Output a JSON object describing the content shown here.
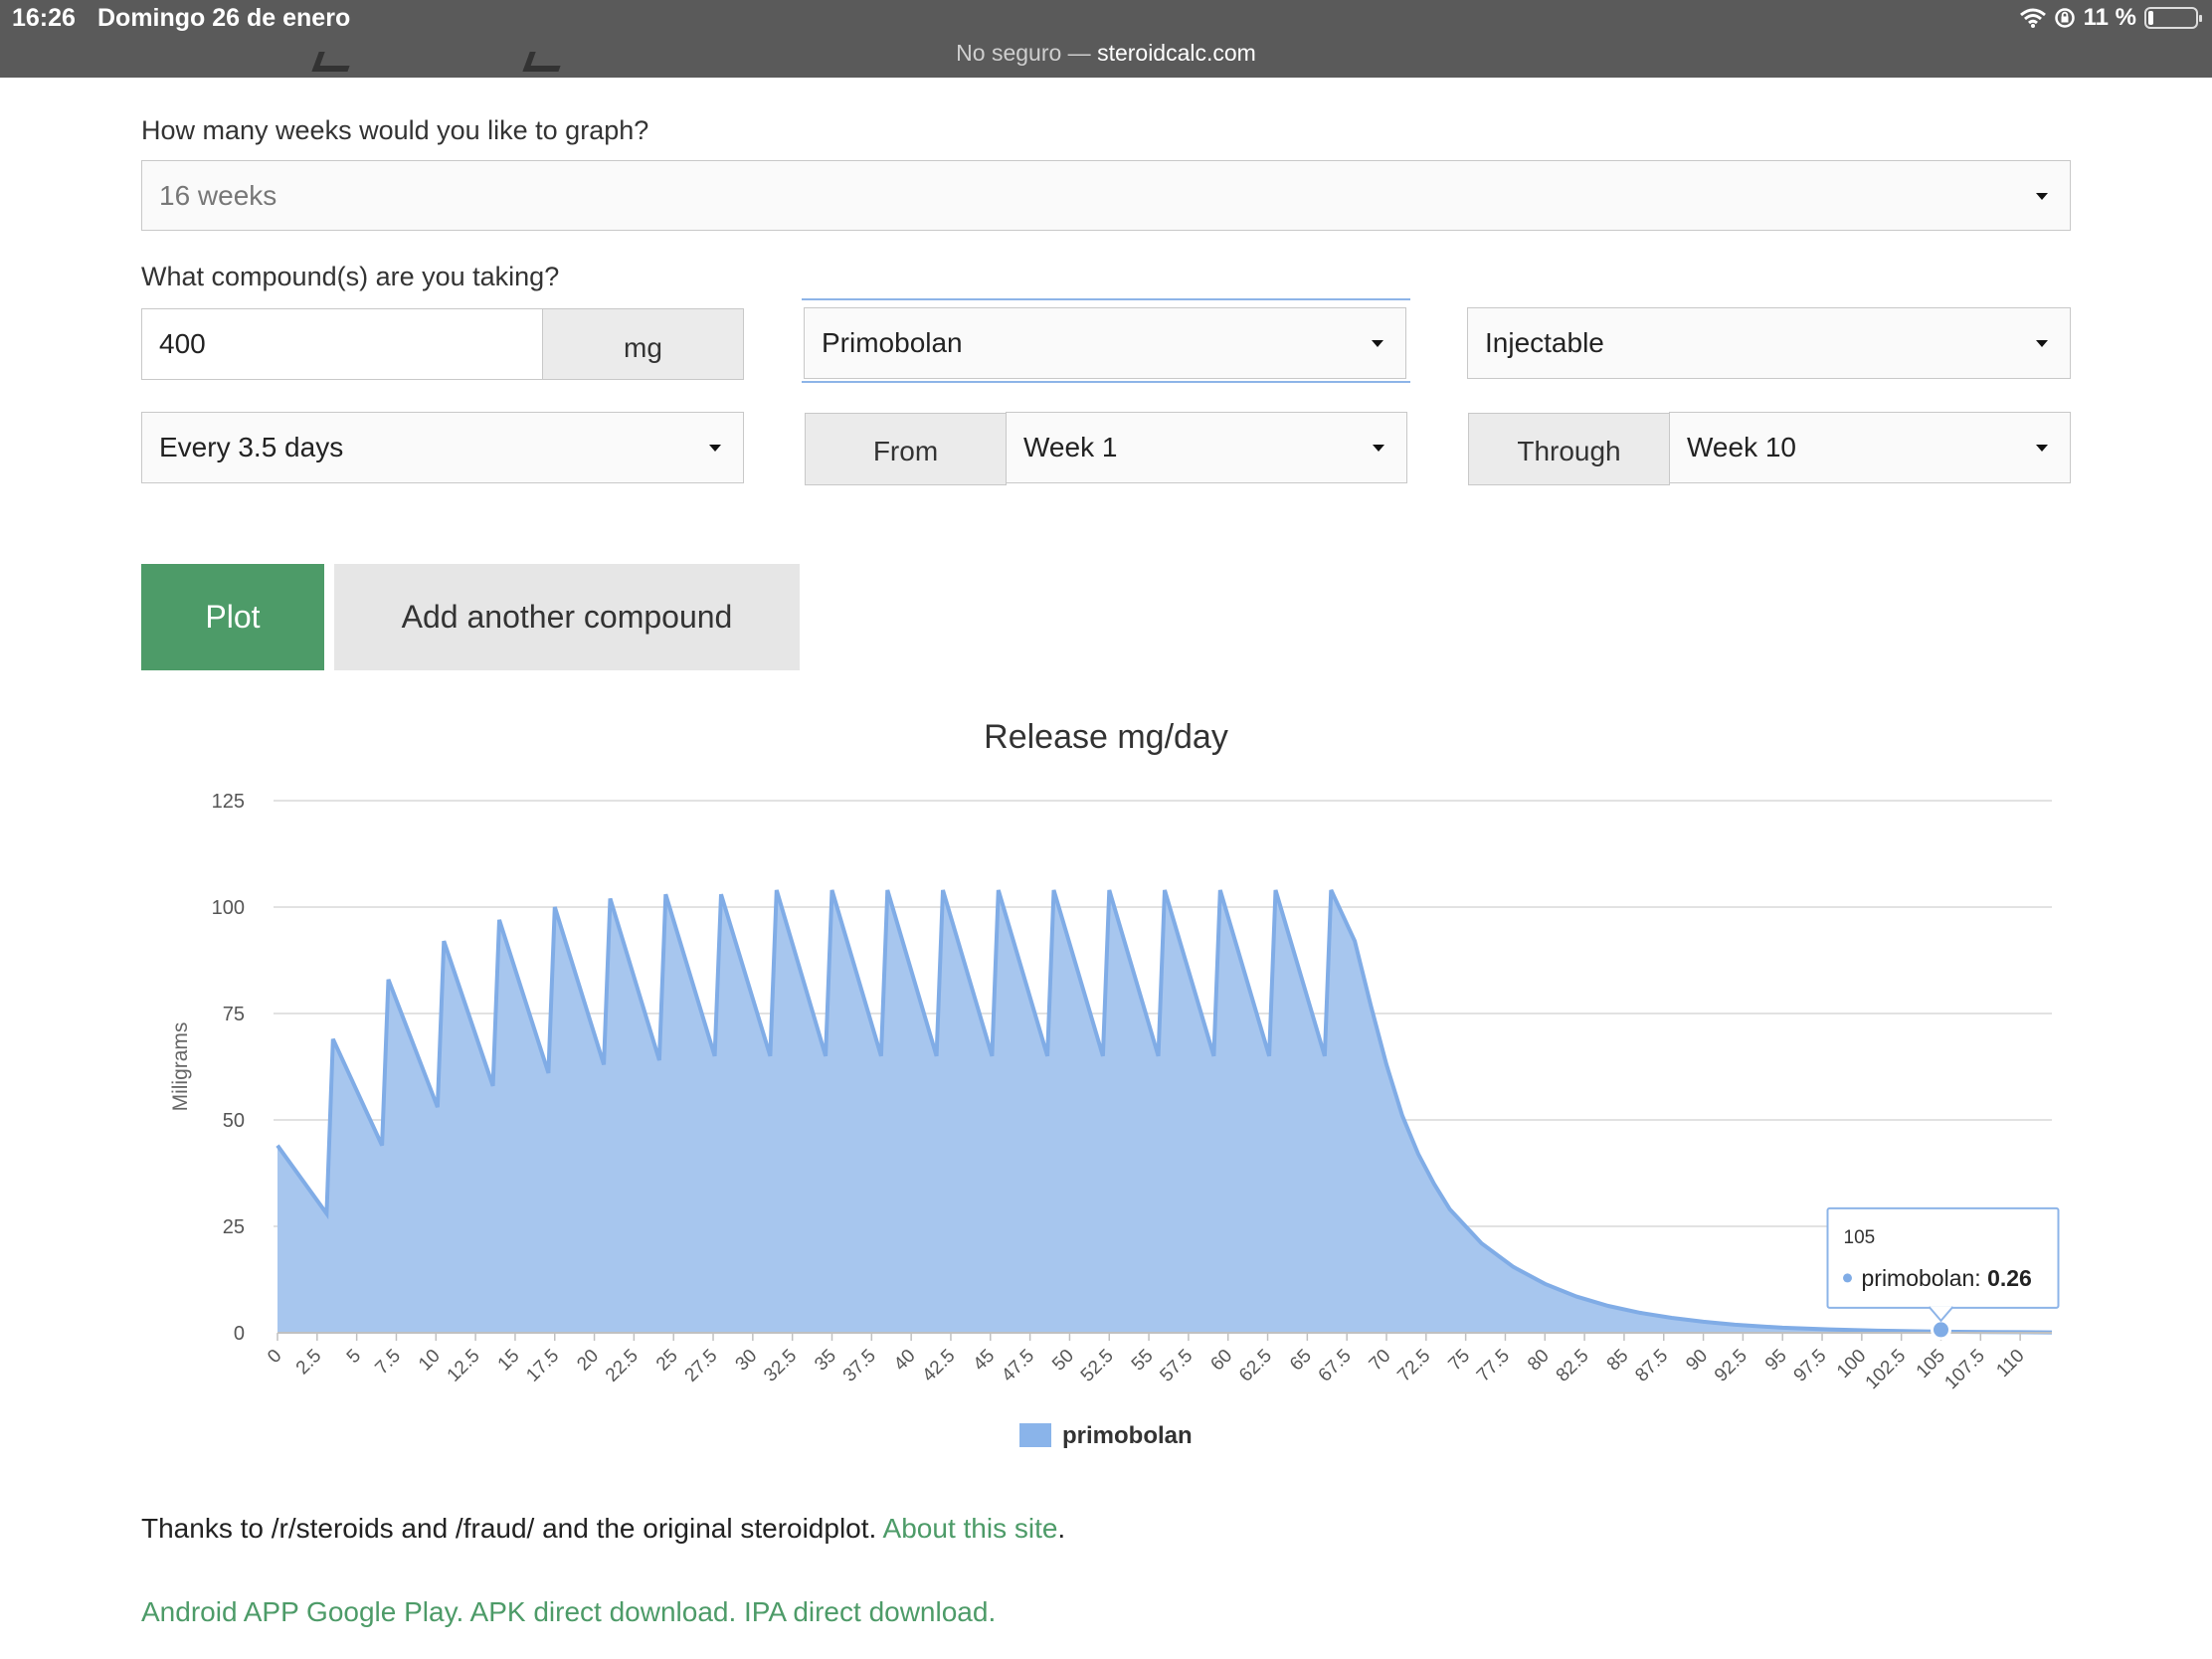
{
  "status_bar": {
    "time": "16:26",
    "date": "Domingo 26 de enero",
    "not_secure": "No seguro —",
    "domain": "steroidcalc.com",
    "battery": "11 %",
    "battery_level": 0.11
  },
  "form": {
    "weeks_label": "How many weeks would you like to graph?",
    "weeks_value": "16 weeks",
    "compounds_label": "What compound(s) are you taking?",
    "dose_value": "400",
    "dose_unit": "mg",
    "compound_value": "Primobolan",
    "route_value": "Injectable",
    "frequency_value": "Every 3.5 days",
    "from_label": "From",
    "from_value": "Week 1",
    "through_label": "Through",
    "through_value": "Week 10"
  },
  "buttons": {
    "plot": "Plot",
    "add_compound": "Add another compound"
  },
  "chart_data": {
    "type": "area",
    "title": "Release mg/day",
    "ylabel": "Miligrams",
    "xlabel": "",
    "ylim": [
      0,
      125
    ],
    "xlim": [
      0,
      112
    ],
    "y_ticks": [
      "0",
      "25",
      "50",
      "75",
      "100",
      "125"
    ],
    "x_ticks": [
      "0",
      "2.5",
      "5",
      "7.5",
      "10",
      "12.5",
      "15",
      "17.5",
      "20",
      "22.5",
      "25",
      "27.5",
      "30",
      "32.5",
      "35",
      "37.5",
      "40",
      "42.5",
      "45",
      "47.5",
      "50",
      "52.5",
      "55",
      "57.5",
      "60",
      "62.5",
      "65",
      "67.5",
      "70",
      "72.5",
      "75",
      "77.5",
      "80",
      "82.5",
      "85",
      "87.5",
      "90",
      "92.5",
      "95",
      "97.5",
      "100",
      "102.5",
      "105",
      "107.5",
      "110"
    ],
    "grid": true,
    "legend_position": "bottom",
    "series": [
      {
        "name": "primobolan",
        "color": "#8ab4ea",
        "points": [
          [
            0,
            44
          ],
          [
            3.1,
            28
          ],
          [
            3.5,
            69
          ],
          [
            6.6,
            44
          ],
          [
            7,
            83
          ],
          [
            10.1,
            53
          ],
          [
            10.5,
            92
          ],
          [
            13.6,
            58
          ],
          [
            14,
            97
          ],
          [
            17.1,
            61
          ],
          [
            17.5,
            100
          ],
          [
            20.6,
            63
          ],
          [
            21,
            102
          ],
          [
            24.1,
            64
          ],
          [
            24.5,
            103
          ],
          [
            27.6,
            65
          ],
          [
            28,
            103
          ],
          [
            31.1,
            65
          ],
          [
            31.5,
            104
          ],
          [
            34.6,
            65
          ],
          [
            35,
            104
          ],
          [
            38.1,
            65
          ],
          [
            38.5,
            104
          ],
          [
            41.6,
            65
          ],
          [
            42,
            104
          ],
          [
            45.1,
            65
          ],
          [
            45.5,
            104
          ],
          [
            48.6,
            65
          ],
          [
            49,
            104
          ],
          [
            52.1,
            65
          ],
          [
            52.5,
            104
          ],
          [
            55.6,
            65
          ],
          [
            56,
            104
          ],
          [
            59.1,
            65
          ],
          [
            59.5,
            104
          ],
          [
            62.6,
            65
          ],
          [
            63,
            104
          ],
          [
            66.1,
            65
          ],
          [
            66.5,
            104
          ],
          [
            68,
            92
          ],
          [
            69,
            77
          ],
          [
            70,
            63
          ],
          [
            71,
            51
          ],
          [
            72,
            42
          ],
          [
            73,
            35
          ],
          [
            74,
            29
          ],
          [
            76,
            21
          ],
          [
            78,
            15.5
          ],
          [
            80,
            11.5
          ],
          [
            82,
            8.5
          ],
          [
            84,
            6.3
          ],
          [
            86,
            4.7
          ],
          [
            88,
            3.5
          ],
          [
            90,
            2.6
          ],
          [
            92,
            1.9
          ],
          [
            95,
            1.2
          ],
          [
            98,
            0.8
          ],
          [
            101,
            0.5
          ],
          [
            105,
            0.26
          ],
          [
            108,
            0.18
          ],
          [
            112,
            0.1
          ]
        ]
      }
    ],
    "tooltip": {
      "x_label": "105",
      "series": "primobolan",
      "value_text": "0.26",
      "x": 105,
      "y": 0.26
    }
  },
  "footer": {
    "thanks_text": "Thanks to /r/steroids and /fraud/ and the original steroidplot.",
    "about_link": "About this site",
    "period": ".",
    "android_link": "Android APP Google Play.",
    "apk_link": "APK direct download.",
    "ipa_link": "IPA direct download."
  }
}
